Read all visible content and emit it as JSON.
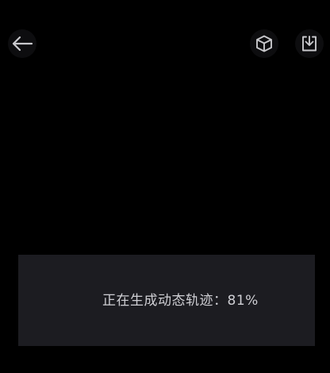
{
  "header": {
    "back_icon": "arrow-left-icon",
    "model_icon": "cube-icon",
    "download_icon": "download-icon"
  },
  "progress": {
    "message": "正在生成动态轨迹：",
    "percent_text": "81%",
    "percent": 81
  },
  "colors": {
    "background": "#000000",
    "panel": "#1c1c21",
    "icon": "#c8c8cc",
    "text": "#cfcfd4"
  }
}
